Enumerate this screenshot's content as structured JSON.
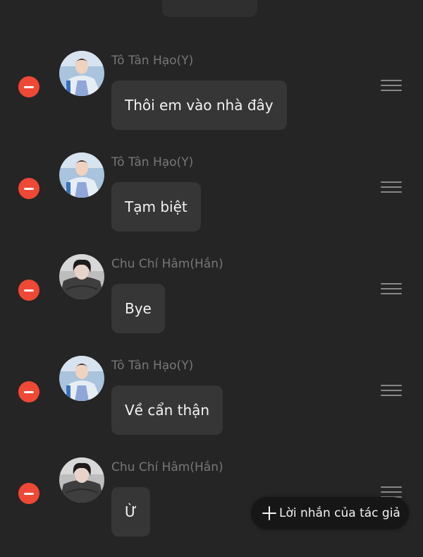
{
  "messages": [
    {
      "sender": "Tô Tân Hạo(Y)",
      "text": "Thôi em vào nhà đây",
      "avatar": "avatar-boy-light"
    },
    {
      "sender": "Tô Tân Hạo(Y)",
      "text": "Tạm biệt",
      "avatar": "avatar-boy-light"
    },
    {
      "sender": "Chu Chí Hâm(Hắn)",
      "text": "Bye",
      "avatar": "avatar-boy-dark"
    },
    {
      "sender": "Tô Tân Hạo(Y)",
      "text": "Về cẩn thận",
      "avatar": "avatar-boy-light"
    },
    {
      "sender": "Chu Chí Hâm(Hắn)",
      "text": "Ừ",
      "avatar": "avatar-boy-dark"
    }
  ],
  "author_note_button": {
    "label": "Lời nhắn của tác giả",
    "icon": "plus-icon"
  },
  "colors": {
    "background": "#252525",
    "bubble": "#363636",
    "delete": "#ef4836",
    "sender_name": "#777777"
  }
}
